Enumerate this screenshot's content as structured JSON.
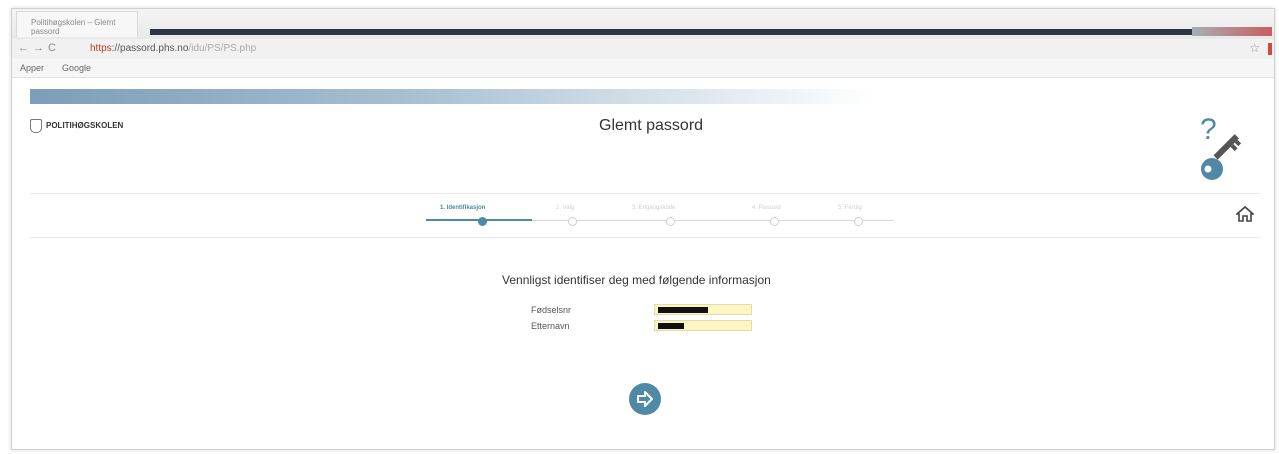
{
  "browser": {
    "tab_title": "Politihøgskolen – Glemt passord",
    "url_protocol": "https",
    "url_host": "passord.phs.no",
    "url_path": "/idu/PS/PS.php",
    "bookmarks": [
      "Apper",
      "Google"
    ]
  },
  "header": {
    "logo_text": "POLITIHØGSKOLEN",
    "title": "Glemt passord",
    "help_icon": "question-key-icon"
  },
  "steps": [
    {
      "label": "1. Identifikasjon",
      "active": true
    },
    {
      "label": "2. Valg",
      "active": false
    },
    {
      "label": "3. Engangskode",
      "active": false
    },
    {
      "label": "4. Passord",
      "active": false
    },
    {
      "label": "5. Ferdig",
      "active": false
    }
  ],
  "nav": {
    "home_icon": "home-icon"
  },
  "form": {
    "instruction": "Vennligst identifiser deg med følgende informasjon",
    "birthdate_label": "Fødselsnr",
    "lastname_label": "Etternavn",
    "birthdate_value": "redacted",
    "lastname_value": "redacted",
    "submit_icon": "arrow-right-icon"
  },
  "colors": {
    "accent": "#4f89a5",
    "field_bg": "#fbf6c2",
    "banner": "#7d9db8"
  }
}
